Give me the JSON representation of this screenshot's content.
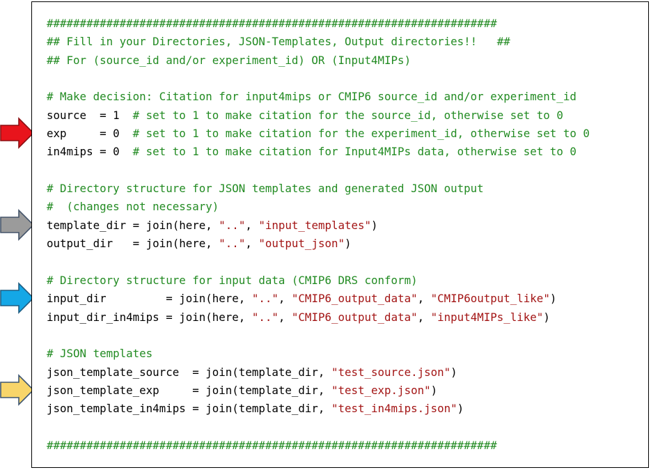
{
  "code_lines": [
    [
      {
        "t": "cm",
        "v": "####################################################################"
      }
    ],
    [
      {
        "t": "cm",
        "v": "## Fill in your Directories, JSON-Templates, Output directories!!   ##"
      }
    ],
    [
      {
        "t": "cm",
        "v": "## For (source_id and/or experiment_id) OR (Input4MIPs)"
      }
    ],
    [],
    [
      {
        "t": "cm",
        "v": "# Make decision: Citation for input4mips or CMIP6 source_id and/or experiment_id"
      }
    ],
    [
      {
        "t": "pl",
        "v": "source  = 1  "
      },
      {
        "t": "cm",
        "v": "# set to 1 to make citation for the source_id, otherwise set to 0"
      }
    ],
    [
      {
        "t": "pl",
        "v": "exp     = 0  "
      },
      {
        "t": "cm",
        "v": "# set to 1 to make citation for the experiment_id, otherwise set to 0"
      }
    ],
    [
      {
        "t": "pl",
        "v": "in4mips = 0  "
      },
      {
        "t": "cm",
        "v": "# set to 1 to make citation for Input4MIPs data, otherwise set to 0"
      }
    ],
    [],
    [
      {
        "t": "cm",
        "v": "# Directory structure for JSON templates and generated JSON output"
      }
    ],
    [
      {
        "t": "cm",
        "v": "#  (changes not necessary)"
      }
    ],
    [
      {
        "t": "pl",
        "v": "template_dir = join(here, "
      },
      {
        "t": "st",
        "v": "\"..\""
      },
      {
        "t": "pl",
        "v": ", "
      },
      {
        "t": "st",
        "v": "\"input_templates\""
      },
      {
        "t": "pl",
        "v": ")"
      }
    ],
    [
      {
        "t": "pl",
        "v": "output_dir   = join(here, "
      },
      {
        "t": "st",
        "v": "\"..\""
      },
      {
        "t": "pl",
        "v": ", "
      },
      {
        "t": "st",
        "v": "\"output_json\""
      },
      {
        "t": "pl",
        "v": ")"
      }
    ],
    [],
    [
      {
        "t": "cm",
        "v": "# Directory structure for input data (CMIP6 DRS conform)"
      }
    ],
    [
      {
        "t": "pl",
        "v": "input_dir         = join(here, "
      },
      {
        "t": "st",
        "v": "\"..\""
      },
      {
        "t": "pl",
        "v": ", "
      },
      {
        "t": "st",
        "v": "\"CMIP6_output_data\""
      },
      {
        "t": "pl",
        "v": ", "
      },
      {
        "t": "st",
        "v": "\"CMIP6output_like\""
      },
      {
        "t": "pl",
        "v": ")"
      }
    ],
    [
      {
        "t": "pl",
        "v": "input_dir_in4mips = join(here, "
      },
      {
        "t": "st",
        "v": "\"..\""
      },
      {
        "t": "pl",
        "v": ", "
      },
      {
        "t": "st",
        "v": "\"CMIP6_output_data\""
      },
      {
        "t": "pl",
        "v": ", "
      },
      {
        "t": "st",
        "v": "\"input4MIPs_like\""
      },
      {
        "t": "pl",
        "v": ")"
      }
    ],
    [],
    [
      {
        "t": "cm",
        "v": "# JSON templates"
      }
    ],
    [
      {
        "t": "pl",
        "v": "json_template_source  = join(template_dir, "
      },
      {
        "t": "st",
        "v": "\"test_source.json\""
      },
      {
        "t": "pl",
        "v": ")"
      }
    ],
    [
      {
        "t": "pl",
        "v": "json_template_exp     = join(template_dir, "
      },
      {
        "t": "st",
        "v": "\"test_exp.json\""
      },
      {
        "t": "pl",
        "v": ")"
      }
    ],
    [
      {
        "t": "pl",
        "v": "json_template_in4mips = join(template_dir, "
      },
      {
        "t": "st",
        "v": "\"test_in4mips.json\""
      },
      {
        "t": "pl",
        "v": ")"
      }
    ],
    [],
    [
      {
        "t": "cm",
        "v": "####################################################################"
      }
    ]
  ],
  "arrows": [
    {
      "name": "red-arrow-marker",
      "color": "#e8141c",
      "stroke": "#8b0f12",
      "points_to_line": 6
    },
    {
      "name": "gray-arrow-marker",
      "color": "#9b9b9b",
      "stroke": "#44546a",
      "points_to_line": 11
    },
    {
      "name": "blue-arrow-marker",
      "color": "#14a7e6",
      "stroke": "#1f5d82",
      "points_to_line": 15
    },
    {
      "name": "yellow-arrow-marker",
      "color": "#f8d56a",
      "stroke": "#3e5672",
      "points_to_line": 20
    }
  ],
  "colors": {
    "comment": "#228b22",
    "string": "#a31515",
    "plain": "#000000",
    "frame_border": "#000000"
  }
}
